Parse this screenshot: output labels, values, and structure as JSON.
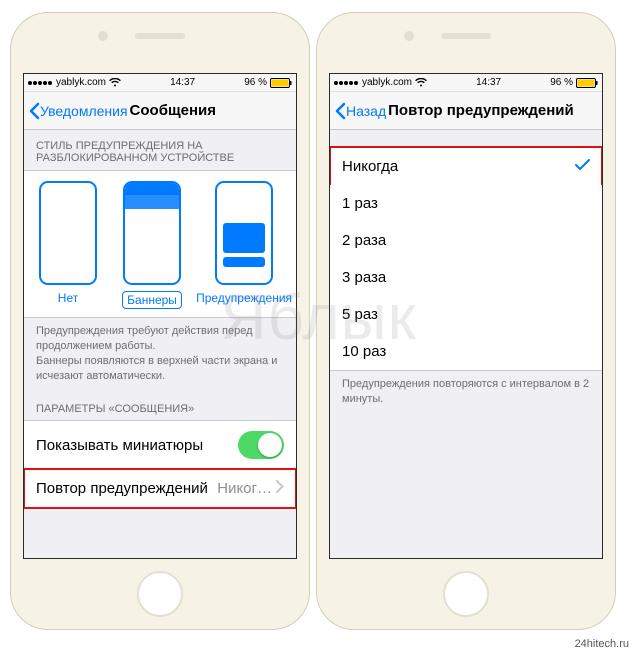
{
  "statusbar": {
    "carrier": "yablyk.com",
    "time": "14:37",
    "battery_text": "96 %"
  },
  "left_phone": {
    "nav": {
      "back": "Уведомления",
      "title": "Сообщения"
    },
    "alert_style_header": "СТИЛЬ ПРЕДУПРЕЖДЕНИЯ НА РАЗБЛОКИРОВАННОМ УСТРОЙСТВЕ",
    "styles": {
      "none": "Нет",
      "banners": "Баннеры",
      "alerts": "Предупреждения"
    },
    "alert_style_footer": "Предупреждения требуют действия перед продолжением работы.\nБаннеры появляются в верхней части экрана и исчезают автоматически.",
    "params_header": "ПАРАМЕТРЫ «СООБЩЕНИЯ»",
    "show_previews_label": "Показывать миниатюры",
    "repeat_label": "Повтор предупреждений",
    "repeat_value": "Никог…"
  },
  "right_phone": {
    "nav": {
      "back": "Назад",
      "title": "Повтор предупреждений"
    },
    "options": [
      "Никогда",
      "1 раз",
      "2 раза",
      "3 раза",
      "5 раз",
      "10 раз"
    ],
    "selected_index": 0,
    "footer": "Предупреждения повторяются с интервалом в 2 минуты."
  },
  "watermark": "Яблык",
  "attribution": "24hitech.ru"
}
